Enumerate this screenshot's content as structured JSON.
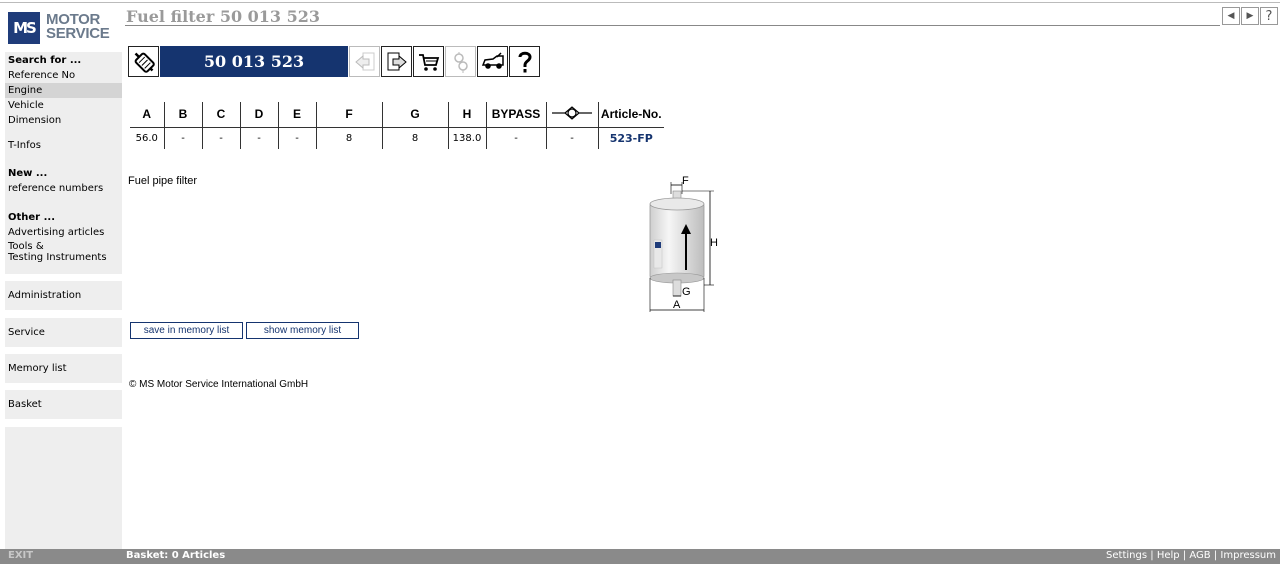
{
  "logo": {
    "mark": "MS",
    "line1": "MOTOR",
    "line2": "SERVICE"
  },
  "sidebar": {
    "search_head": "Search for ...",
    "search_items": [
      "Reference No",
      "Engine",
      "Vehicle",
      "Dimension"
    ],
    "active_item": "Engine",
    "tinfos": "T-Infos",
    "new_head": "New ...",
    "new_items": [
      "reference numbers"
    ],
    "other_head": "Other ...",
    "other_items": [
      "Advertising articles",
      "Tools & Testing Instruments"
    ],
    "tools_line1": "Tools &",
    "tools_line2": "Testing Instruments",
    "blocks": [
      "Administration",
      "Service",
      "Memory list",
      "Basket"
    ]
  },
  "header": {
    "title": "Fuel filter 50 013 523",
    "nav": {
      "prev": "◀",
      "next": "▶",
      "help": "?"
    }
  },
  "toolbar": {
    "article_number": "50 013 523",
    "icons": [
      "filter-icon",
      "back-icon",
      "forward-icon",
      "cart-icon",
      "engine-icon",
      "vehicle-icon",
      "help-icon"
    ]
  },
  "dimensions": {
    "headers": [
      "A",
      "B",
      "C",
      "D",
      "E",
      "F",
      "G",
      "H",
      "BYPASS",
      "",
      "Article-No."
    ],
    "values": [
      "56.0",
      "-",
      "-",
      "-",
      "-",
      "8",
      "8",
      "138.0",
      "-",
      "-",
      "523-FP"
    ]
  },
  "description": "Fuel pipe filter",
  "diagram_labels": {
    "F": "F",
    "H": "H",
    "G": "G",
    "A": "A"
  },
  "buttons": {
    "save": "save in memory list",
    "show": "show memory list"
  },
  "copyright": "© MS Motor Service International GmbH",
  "footer": {
    "exit": "EXIT",
    "basket": "Basket: 0 Articles",
    "links": [
      "Settings",
      "Help",
      "AGB",
      "Impressum"
    ],
    "separator": "|"
  },
  "colors": {
    "brand_blue": "#15346f",
    "sidebar_bg": "#eeeeee",
    "footer_bg": "#8a8a8a"
  }
}
